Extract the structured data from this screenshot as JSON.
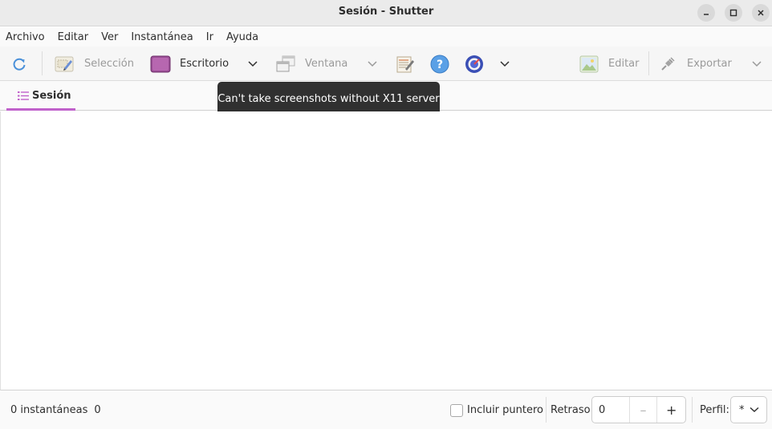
{
  "window": {
    "title": "Sesión - Shutter",
    "minimize_icon": "minimize-icon",
    "maximize_icon": "maximize-icon",
    "close_icon": "close-icon"
  },
  "menubar": {
    "items": [
      "Archivo",
      "Editar",
      "Ver",
      "Instantánea",
      "Ir",
      "Ayuda"
    ]
  },
  "toolbar": {
    "refresh_icon": "refresh-icon",
    "selection_label": "Selección",
    "desktop_label": "Escritorio",
    "window_label": "Ventana",
    "edit_label": "Editar",
    "export_label": "Exportar"
  },
  "tabs": {
    "session_label": "Sesión"
  },
  "tooltip": {
    "text": "Can't take screenshots without X11 server"
  },
  "statusbar": {
    "count_label": "0 instantáneas",
    "count_value": "0",
    "include_pointer_label": "Incluir puntero",
    "include_pointer_checked": false,
    "delay_label": "Retraso:",
    "delay_value": "0",
    "delay_minus": "–",
    "delay_plus": "+",
    "profile_label": "Perfil:",
    "profile_value": "*"
  },
  "colors": {
    "accent": "#c061cb",
    "tooltip_bg": "#303030",
    "refresh_blue": "#4a90d9",
    "help_blue": "#5aa0e6",
    "desktop_purple": "#9b4f96"
  }
}
